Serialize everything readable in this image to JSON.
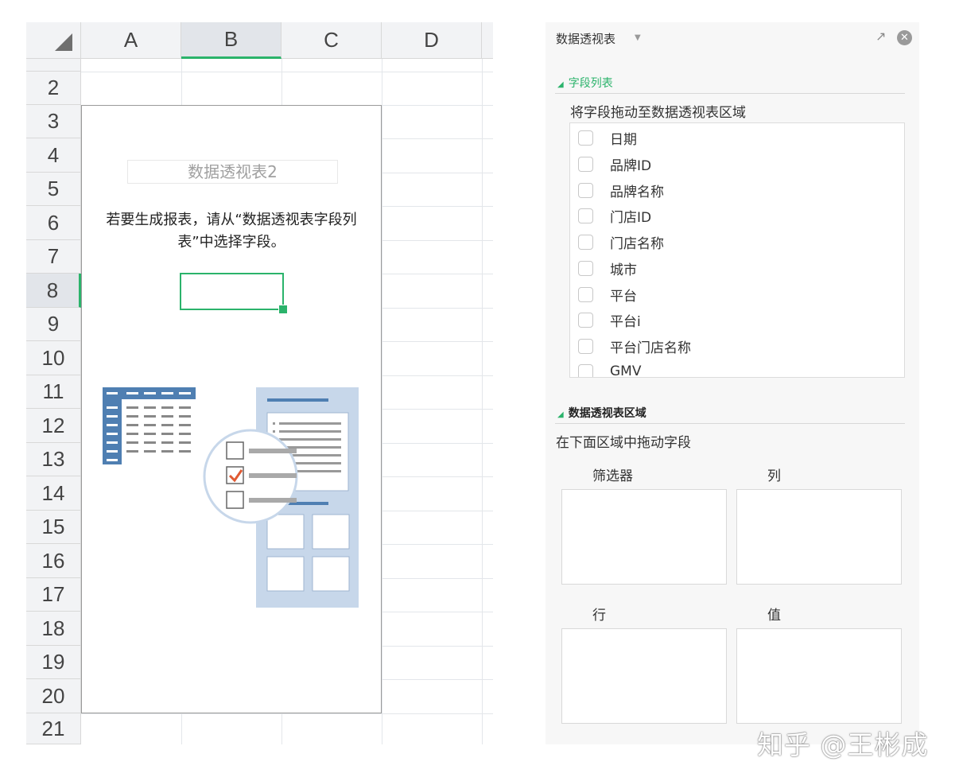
{
  "sheet": {
    "columns": [
      "A",
      "B",
      "C",
      "D"
    ],
    "selected_column": "B",
    "rows": [
      "2",
      "3",
      "4",
      "5",
      "6",
      "7",
      "8",
      "9",
      "10",
      "11",
      "12",
      "13",
      "14",
      "15",
      "16",
      "17",
      "18",
      "19",
      "20",
      "21"
    ],
    "selected_row": "8",
    "pivot_placeholder": {
      "name": "数据透视表2",
      "hint": "若要生成报表，请从“数据透视表字段列表”中选择字段。"
    }
  },
  "panel": {
    "title": "数据透视表",
    "close_icon": "✕",
    "expand_icon": "↗",
    "field_section": {
      "title": "字段列表",
      "subtitle": "将字段拖动至数据透视表区域",
      "fields": [
        "日期",
        "品牌ID",
        "品牌名称",
        "门店ID",
        "门店名称",
        "城市",
        "平台",
        "平台i",
        "平台门店名称",
        "GMV"
      ]
    },
    "area_section": {
      "title": "数据透视表区域",
      "subtitle": "在下面区域中拖动字段",
      "zones": {
        "filter": "筛选器",
        "columns": "列",
        "rows": "行",
        "values": "值"
      }
    }
  },
  "watermark": "知乎 @王彬成",
  "colors": {
    "accent": "#2bb36b",
    "illustration_blue": "#4f7fb2",
    "illustration_light": "#c7d7ea",
    "check_red": "#e05a33"
  }
}
